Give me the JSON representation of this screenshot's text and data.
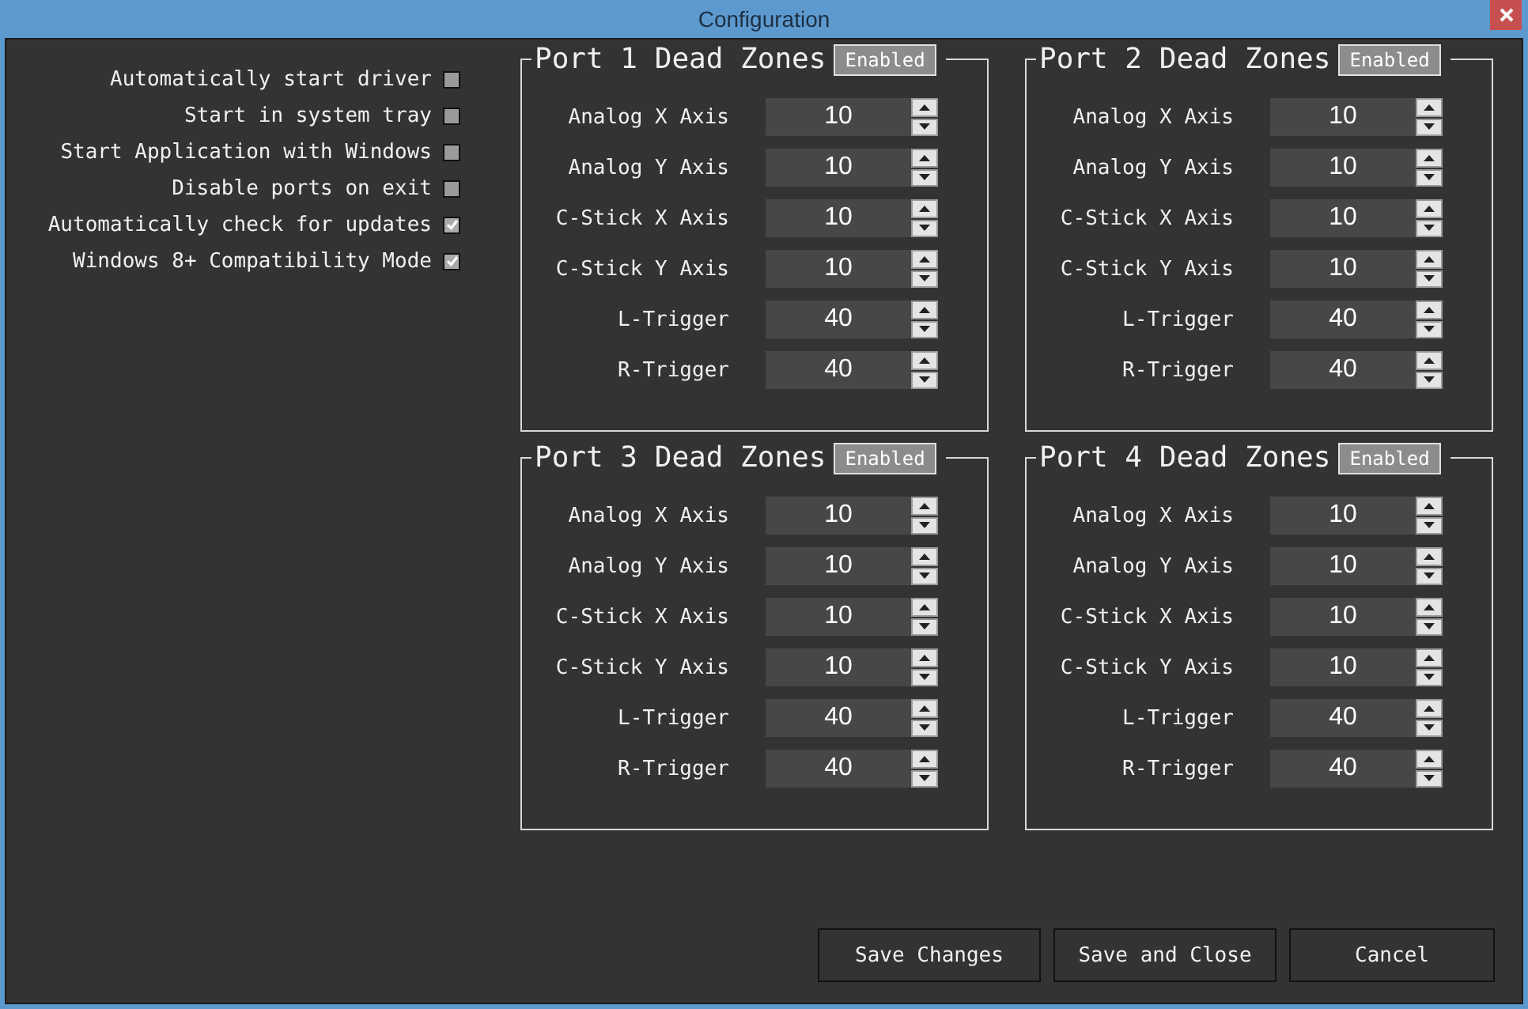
{
  "window": {
    "title": "Configuration"
  },
  "options": [
    {
      "label": "Automatically start driver",
      "checked": false
    },
    {
      "label": "Start in system tray",
      "checked": false
    },
    {
      "label": "Start Application with Windows",
      "checked": false
    },
    {
      "label": "Disable ports on exit",
      "checked": false
    },
    {
      "label": "Automatically check for updates",
      "checked": true
    },
    {
      "label": "Windows 8+ Compatibility Mode",
      "checked": true
    }
  ],
  "ports": [
    {
      "title": "Port 1 Dead Zones",
      "toggle": "Enabled",
      "fields": [
        {
          "label": "Analog X Axis",
          "value": "10"
        },
        {
          "label": "Analog Y Axis",
          "value": "10"
        },
        {
          "label": "C-Stick X Axis",
          "value": "10"
        },
        {
          "label": "C-Stick Y Axis",
          "value": "10"
        },
        {
          "label": "L-Trigger",
          "value": "40"
        },
        {
          "label": "R-Trigger",
          "value": "40"
        }
      ]
    },
    {
      "title": "Port 2 Dead Zones",
      "toggle": "Enabled",
      "fields": [
        {
          "label": "Analog X Axis",
          "value": "10"
        },
        {
          "label": "Analog Y Axis",
          "value": "10"
        },
        {
          "label": "C-Stick X Axis",
          "value": "10"
        },
        {
          "label": "C-Stick Y Axis",
          "value": "10"
        },
        {
          "label": "L-Trigger",
          "value": "40"
        },
        {
          "label": "R-Trigger",
          "value": "40"
        }
      ]
    },
    {
      "title": "Port 3 Dead Zones",
      "toggle": "Enabled",
      "fields": [
        {
          "label": "Analog X Axis",
          "value": "10"
        },
        {
          "label": "Analog Y Axis",
          "value": "10"
        },
        {
          "label": "C-Stick X Axis",
          "value": "10"
        },
        {
          "label": "C-Stick Y Axis",
          "value": "10"
        },
        {
          "label": "L-Trigger",
          "value": "40"
        },
        {
          "label": "R-Trigger",
          "value": "40"
        }
      ]
    },
    {
      "title": "Port 4 Dead Zones",
      "toggle": "Enabled",
      "fields": [
        {
          "label": "Analog X Axis",
          "value": "10"
        },
        {
          "label": "Analog Y Axis",
          "value": "10"
        },
        {
          "label": "C-Stick X Axis",
          "value": "10"
        },
        {
          "label": "C-Stick Y Axis",
          "value": "10"
        },
        {
          "label": "L-Trigger",
          "value": "40"
        },
        {
          "label": "R-Trigger",
          "value": "40"
        }
      ]
    }
  ],
  "buttons": [
    "Save Changes",
    "Save and Close",
    "Cancel"
  ]
}
